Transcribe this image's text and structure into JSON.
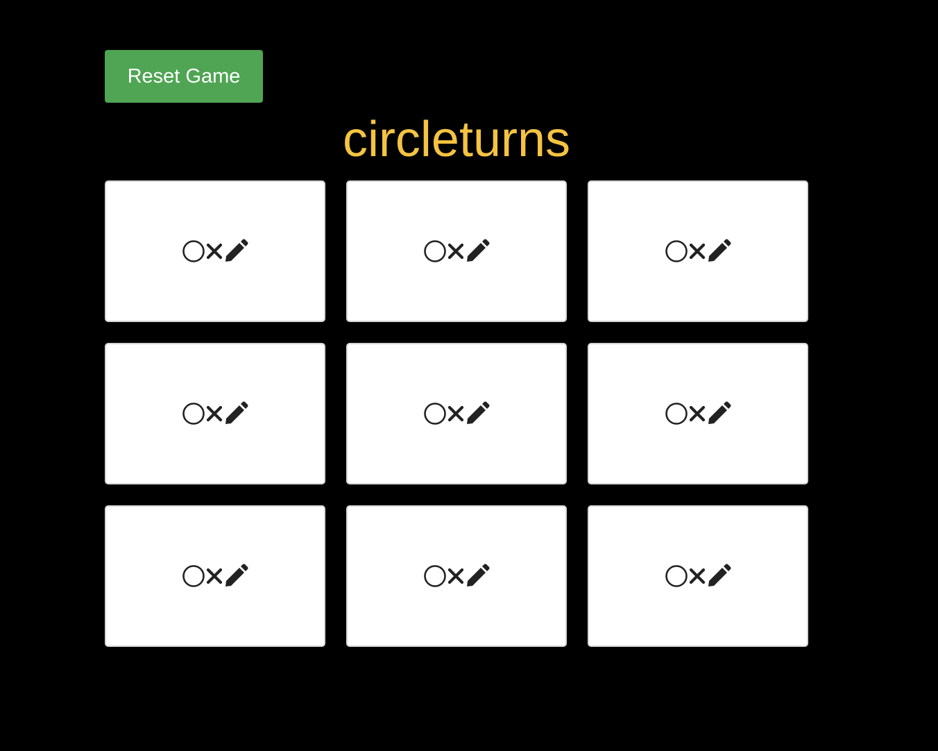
{
  "toolbar": {
    "reset_label": "Reset Game",
    "reset_color": "#4fa553"
  },
  "status": {
    "text": "circleturns",
    "color": "#f5c342"
  },
  "board": {
    "cells": [
      {
        "state": "circle",
        "icon": "circle-icon"
      },
      {
        "state": "empty",
        "icon": "pencil-icon"
      },
      {
        "state": "empty",
        "icon": "pencil-icon"
      },
      {
        "state": "empty",
        "icon": "pencil-icon"
      },
      {
        "state": "cross",
        "icon": "cross-icon"
      },
      {
        "state": "cross",
        "icon": "cross-icon"
      },
      {
        "state": "empty",
        "icon": "pencil-icon"
      },
      {
        "state": "empty",
        "icon": "pencil-icon"
      },
      {
        "state": "circle",
        "icon": "circle-icon"
      }
    ]
  }
}
